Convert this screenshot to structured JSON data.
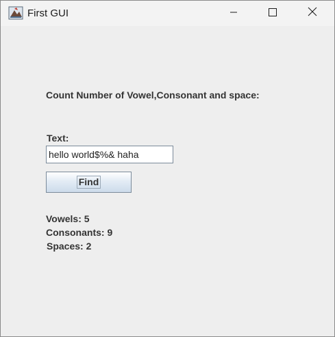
{
  "window": {
    "title": "First GUI"
  },
  "form": {
    "heading": "Count Number of Vowel,Consonant and space:",
    "text_label": "Text:",
    "input_value": "hello world$%& haha",
    "button_label": "Find"
  },
  "results": {
    "vowels": "Vowels: 5",
    "consonants": "Consonants: 9",
    "spaces": "Spaces: 2"
  },
  "icons": {
    "app": "java-app-icon",
    "minimize": "minimize-icon",
    "maximize": "maximize-icon",
    "close": "close-icon"
  }
}
